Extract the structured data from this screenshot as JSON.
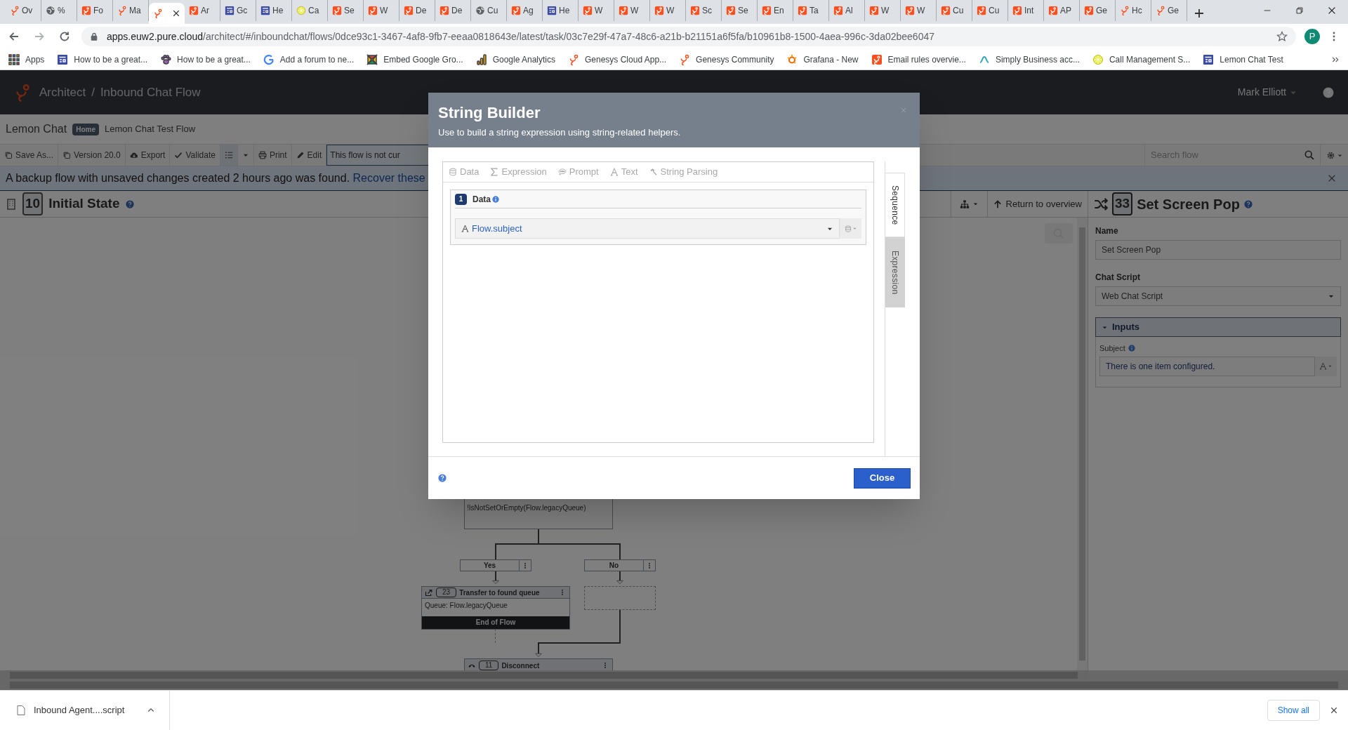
{
  "browser": {
    "tabs": [
      {
        "label": "Ov",
        "selected": false
      },
      {
        "label": "%",
        "selected": false
      },
      {
        "label": "Fo",
        "selected": false
      },
      {
        "label": "Ma",
        "selected": false
      },
      {
        "selected": true
      },
      {
        "label": "Ar",
        "selected": false
      },
      {
        "label": "Gc",
        "selected": false
      },
      {
        "label": "He",
        "selected": false
      },
      {
        "label": "Ca",
        "selected": false
      },
      {
        "label": "Se",
        "selected": false
      },
      {
        "label": "W",
        "selected": false
      },
      {
        "label": "De",
        "selected": false
      },
      {
        "label": "De",
        "selected": false
      },
      {
        "label": "Cu",
        "selected": false
      },
      {
        "label": "Ag",
        "selected": false
      },
      {
        "label": "He",
        "selected": false
      },
      {
        "label": "W",
        "selected": false
      },
      {
        "label": "W",
        "selected": false
      },
      {
        "label": "W",
        "selected": false
      },
      {
        "label": "Sc",
        "selected": false
      },
      {
        "label": "Se",
        "selected": false
      },
      {
        "label": "En",
        "selected": false
      },
      {
        "label": "Ta",
        "selected": false
      },
      {
        "label": "Al",
        "selected": false
      },
      {
        "label": "W",
        "selected": false
      },
      {
        "label": "W",
        "selected": false
      },
      {
        "label": "Cu",
        "selected": false
      },
      {
        "label": "Cu",
        "selected": false
      },
      {
        "label": "Int",
        "selected": false
      },
      {
        "label": "AP",
        "selected": false
      },
      {
        "label": "Ge",
        "selected": false
      },
      {
        "label": "Hc",
        "selected": false
      },
      {
        "label": "Ge",
        "selected": false
      }
    ],
    "address": {
      "host": "apps.euw2.pure.cloud",
      "path": "/architect/#/inboundchat/flows/0dce93c1-3467-4af8-9fb7-eeaa0818643e/latest/task/03c7e29f-47a7-48c6-a21b-b21151a6f5fa/b10961b8-1500-4aea-996c-3da02bee6047"
    },
    "profile": "P",
    "bookmarks": [
      {
        "label": "Apps"
      },
      {
        "label": "How to be a great..."
      },
      {
        "label": "How to be a great..."
      },
      {
        "label": "Add a forum to ne..."
      },
      {
        "label": "Embed Google Gro..."
      },
      {
        "label": "Google Analytics"
      },
      {
        "label": "Genesys Cloud App..."
      },
      {
        "label": "Genesys Community"
      },
      {
        "label": "Grafana - New"
      },
      {
        "label": "Email rules overvie..."
      },
      {
        "label": "Simply Business acc..."
      },
      {
        "label": "Call Management S..."
      },
      {
        "label": "Lemon Chat Test"
      }
    ]
  },
  "app": {
    "breadcrumb": [
      "Architect",
      "/",
      "Inbound Chat Flow"
    ],
    "user": "Mark Elliott",
    "flow": {
      "name": "Lemon Chat",
      "badge": "Home",
      "description": "Lemon Chat Test Flow"
    },
    "toolbar": [
      {
        "label": "Save As...",
        "selected": false
      },
      {
        "label": "Version 20.0",
        "selected": false
      },
      {
        "label": "Export",
        "selected": false
      },
      {
        "label": "Validate",
        "selected": false
      },
      {
        "selected": true
      },
      {
        "selected": false
      },
      {
        "label": "Print",
        "selected": false
      },
      {
        "label": "Edit",
        "selected": false
      }
    ],
    "notice": "This flow is not cur",
    "search": {
      "placeholder": "Search flow"
    },
    "banner": {
      "text": "A backup flow with unsaved changes created 2 hours ago was found.",
      "link": "Recover these"
    },
    "task": {
      "number": "10",
      "title": "Initial State"
    },
    "return_link": "Return to overview",
    "canvas": {
      "condition": "!IsNotSetOrEmpty(Flow.legacyQueue)",
      "branches": [
        "Yes",
        "No"
      ],
      "transfer": {
        "number": "23",
        "title": "Transfer to found queue",
        "detail": "Queue: Flow.legacyQueue",
        "footer": "End of Flow"
      },
      "disconnect": {
        "number": "11",
        "title": "Disconnect"
      }
    },
    "properties": {
      "number": "33",
      "title": "Set Screen Pop",
      "name_label": "Name",
      "name_value": "Set Screen Pop",
      "script_label": "Chat Script",
      "script_value": "Web Chat Script",
      "inputs": {
        "title": "Inputs",
        "expanded": true,
        "subject_label": "Subject",
        "subject_value": "There is one item configured."
      }
    }
  },
  "dialog": {
    "title": "String Builder",
    "subtitle": "Use to build a string expression using string-related helpers.",
    "helpers": [
      {
        "label": "Data",
        "disabled": true
      },
      {
        "label": "Expression",
        "disabled": true
      },
      {
        "label": "Prompt",
        "disabled": true
      },
      {
        "label": "Text",
        "disabled": true
      },
      {
        "label": "String Parsing",
        "disabled": true
      }
    ],
    "items": [
      {
        "index": "1",
        "title": "Data",
        "value": "Flow.subject"
      }
    ],
    "side_tabs": [
      {
        "label": "Sequence",
        "selected": true
      },
      {
        "label": "Expression",
        "selected": false
      }
    ],
    "close_button": "Close"
  },
  "downloads": {
    "file": "Inbound Agent....script",
    "show_all": "Show all"
  }
}
